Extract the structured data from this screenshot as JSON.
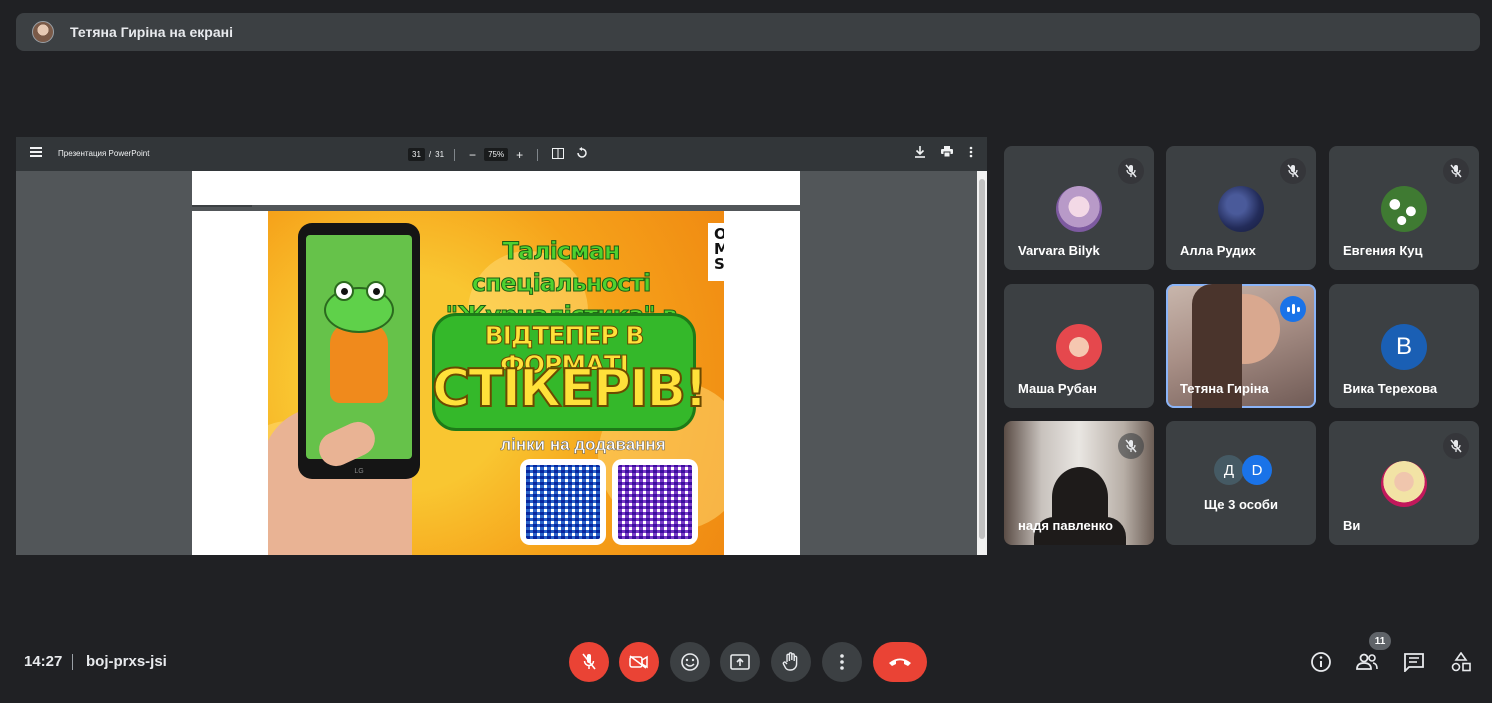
{
  "banner": {
    "text": "Тетяна Гиріна на екрані"
  },
  "pdf": {
    "title": "Презентация PowerPoint",
    "page_current": "31",
    "page_sep": "/",
    "page_total": "31",
    "zoom": "75%"
  },
  "slide": {
    "title_line1": "Талісман спеціальності",
    "title_line2": "\"Журналістика\" в ДПУ",
    "headline1": "ВІДТЕПЕР В ФОРМАТІ",
    "headline2": "СТІКЕРІВ!",
    "links": "лінки на додавання",
    "brand_line1": "OPEN",
    "brand_line2": "MEDIA",
    "brand_line3": "SPACE",
    "phone_brand": "LG"
  },
  "participants": [
    {
      "name": "Varvara Bilyk",
      "muted": true
    },
    {
      "name": "Алла Рудих",
      "muted": true
    },
    {
      "name": "Евгения Куц",
      "muted": true
    },
    {
      "name": "Маша Рубан",
      "muted": false
    },
    {
      "name": "Тетяна Гиріна",
      "speaking": true
    },
    {
      "name": "Вика Терехова",
      "initial": "В"
    },
    {
      "name": "надя павленко",
      "muted": true
    },
    {
      "name": "Ще 3 особи",
      "initials": [
        "Д",
        "D"
      ]
    },
    {
      "name": "Ви",
      "muted": true
    }
  ],
  "meeting": {
    "time": "14:27",
    "code": "boj-prxs-jsi",
    "participants_count": "11"
  },
  "colors": {
    "background": "#202124",
    "tile": "#3c4043",
    "danger": "#ea4335",
    "accent": "#8ab4f8"
  }
}
